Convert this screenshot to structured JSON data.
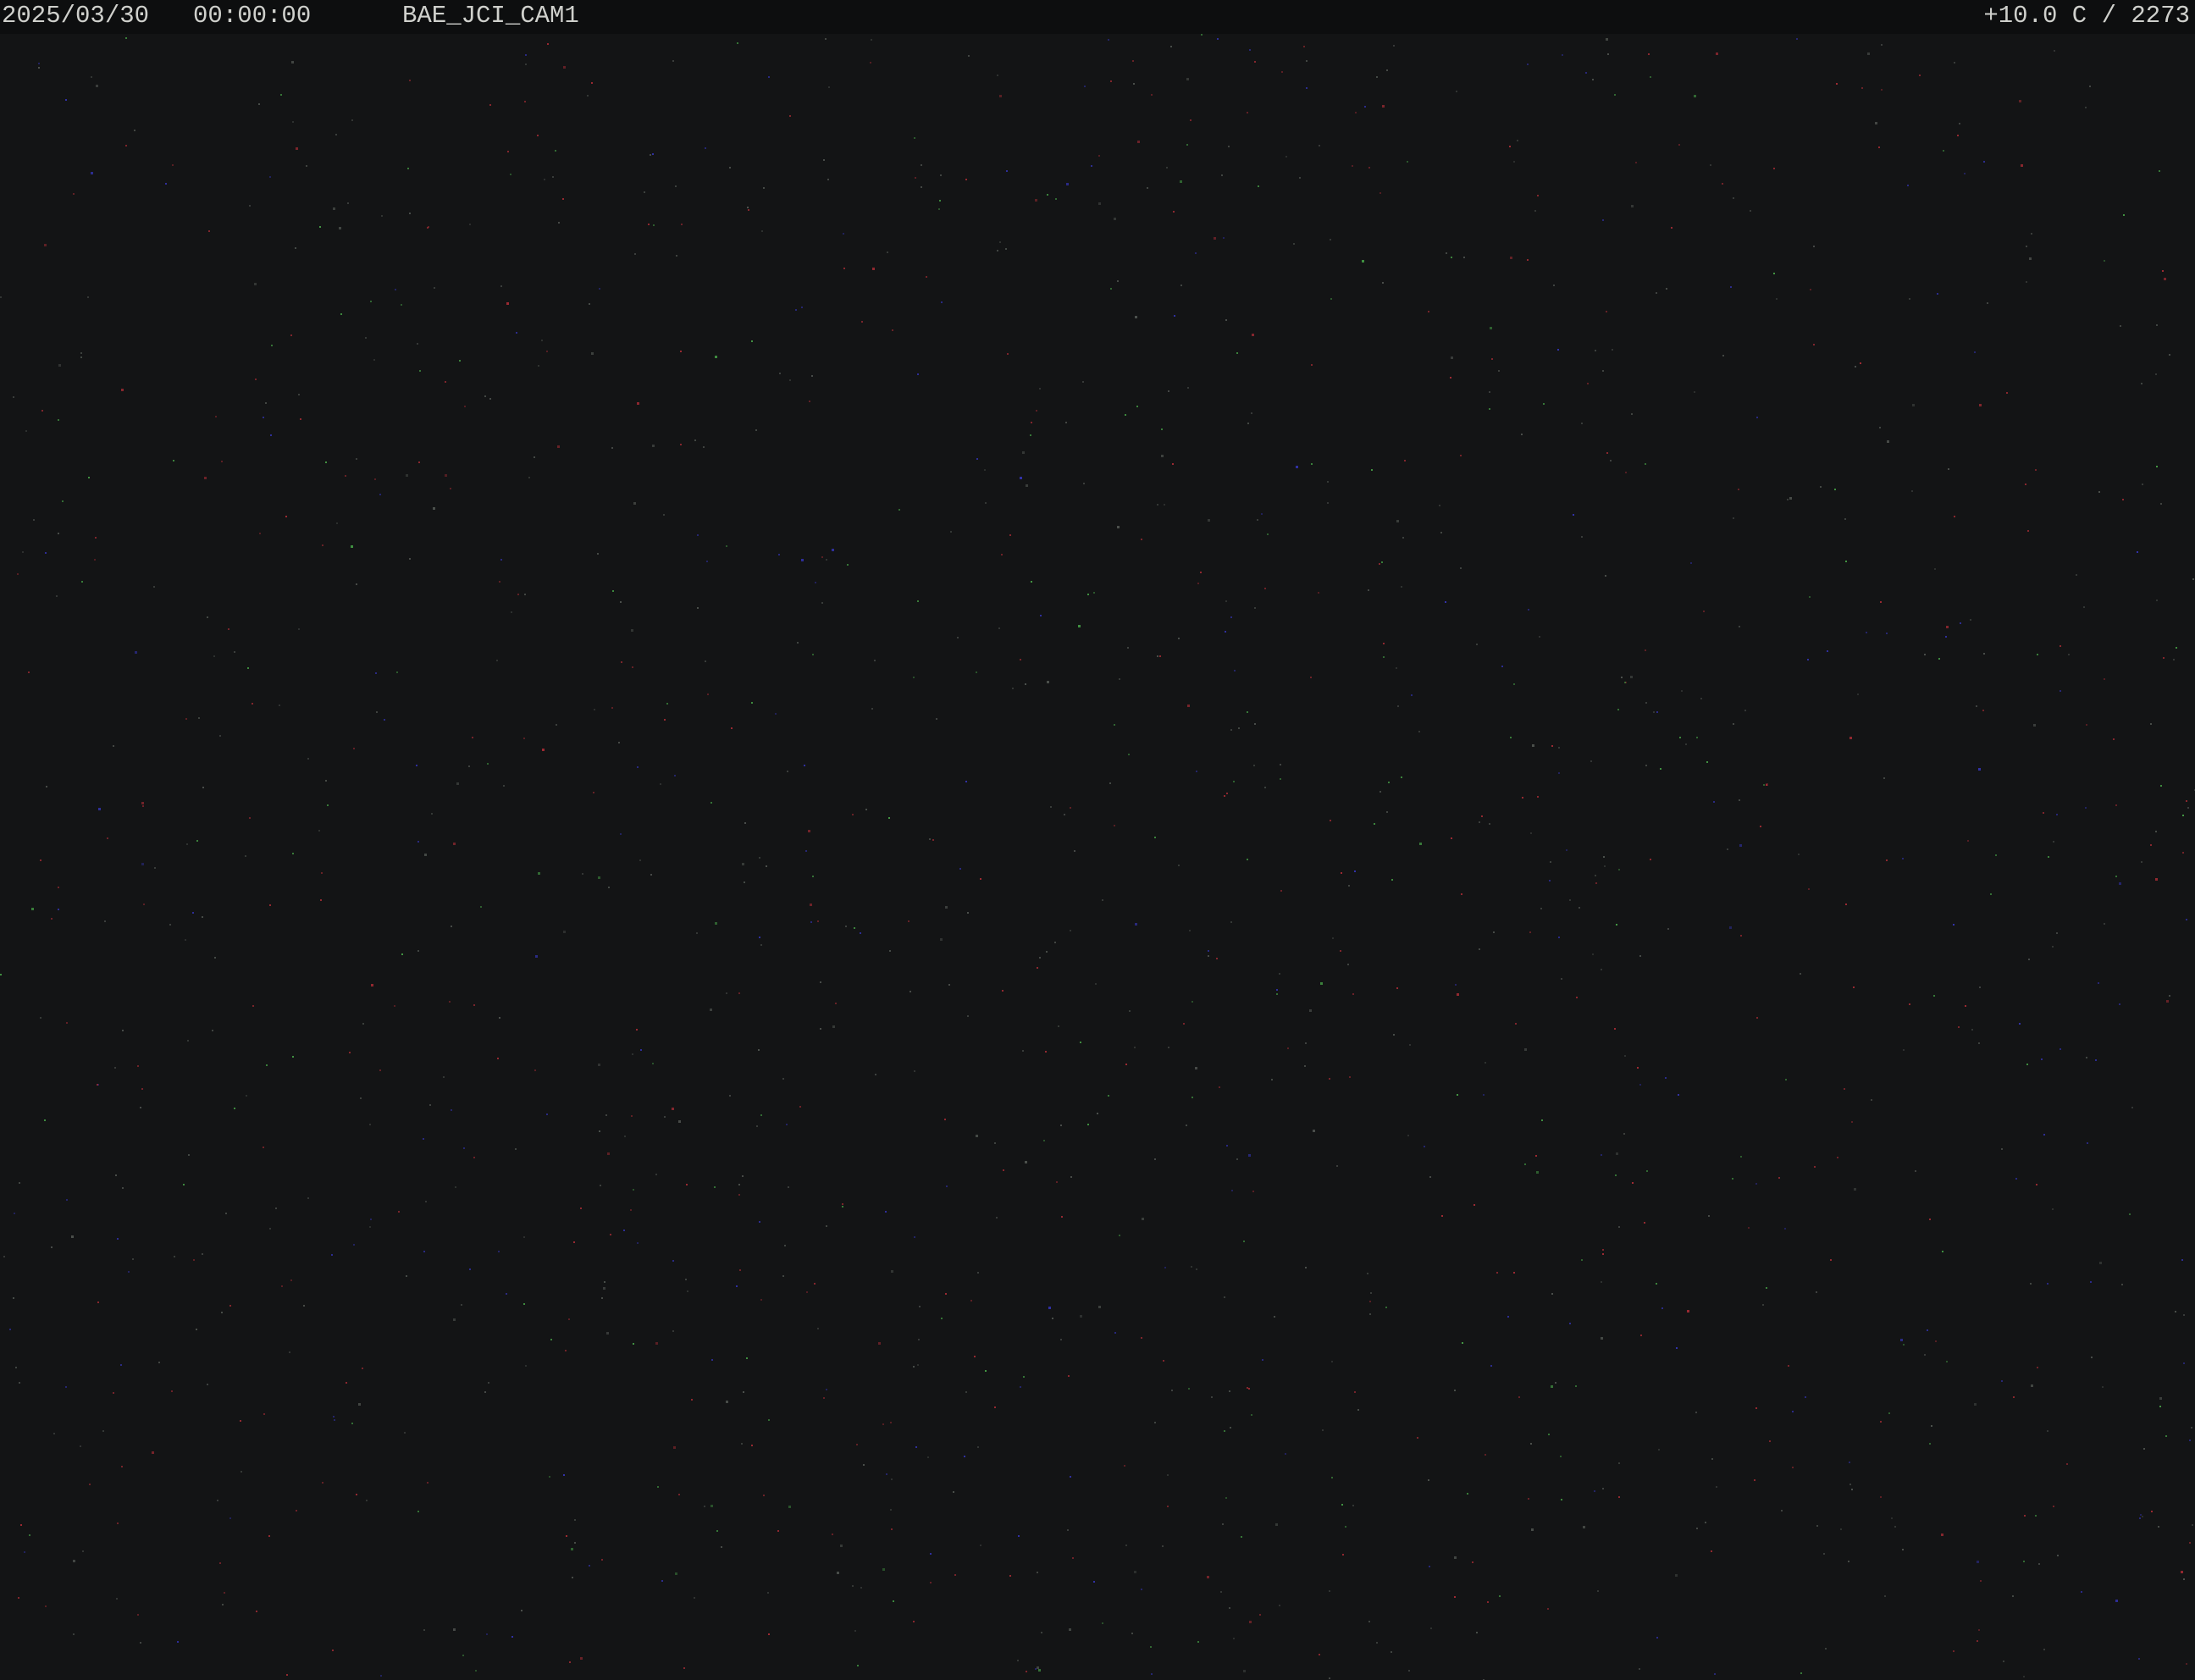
{
  "overlay": {
    "date": "2025/03/30",
    "time": "00:00:00",
    "camera_name": "BAE_JCI_CAM1",
    "sensor_reading": "+10.0 C / 2273"
  },
  "colors": {
    "sky_background": "#131415",
    "overlay_bar": "#0d0e0f",
    "overlay_text": "#cfd0cc",
    "noise_red": "#c0303a",
    "noise_blue": "#3a3ad0",
    "noise_green": "#4fb84f",
    "noise_gray": "#5a5f5a"
  }
}
